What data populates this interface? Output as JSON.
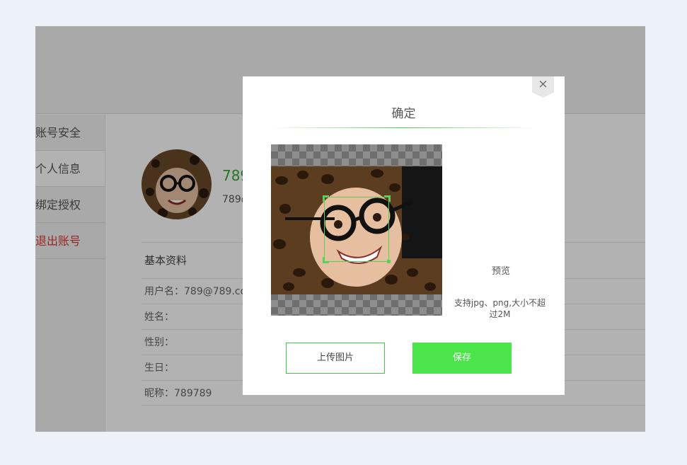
{
  "sidebar": {
    "items": [
      {
        "label": "账号安全"
      },
      {
        "label": "个人信息"
      },
      {
        "label": "绑定授权"
      },
      {
        "label": "退出账号"
      }
    ]
  },
  "profile": {
    "name": "789",
    "email": "789@"
  },
  "basic_info": {
    "title": "基本资料",
    "rows": [
      {
        "label": "用户名：",
        "value": "789@789.co"
      },
      {
        "label": "姓名：",
        "value": ""
      },
      {
        "label": "性别：",
        "value": ""
      },
      {
        "label": "生日：",
        "value": ""
      },
      {
        "label": "昵称：",
        "value": "789789"
      }
    ]
  },
  "modal": {
    "title": "确定",
    "close_symbol": "×",
    "preview_label": "预览",
    "upload_hint": "支持jpg、png,大小不超过2M",
    "upload_button": "上传图片",
    "save_button": "保存"
  },
  "colors": {
    "accent": "#4be54b",
    "page_background": "#edf1f8",
    "logout_text": "#dd3333"
  },
  "icons": {
    "close": "close-icon",
    "crop_corner": "crop-handle-icon"
  }
}
